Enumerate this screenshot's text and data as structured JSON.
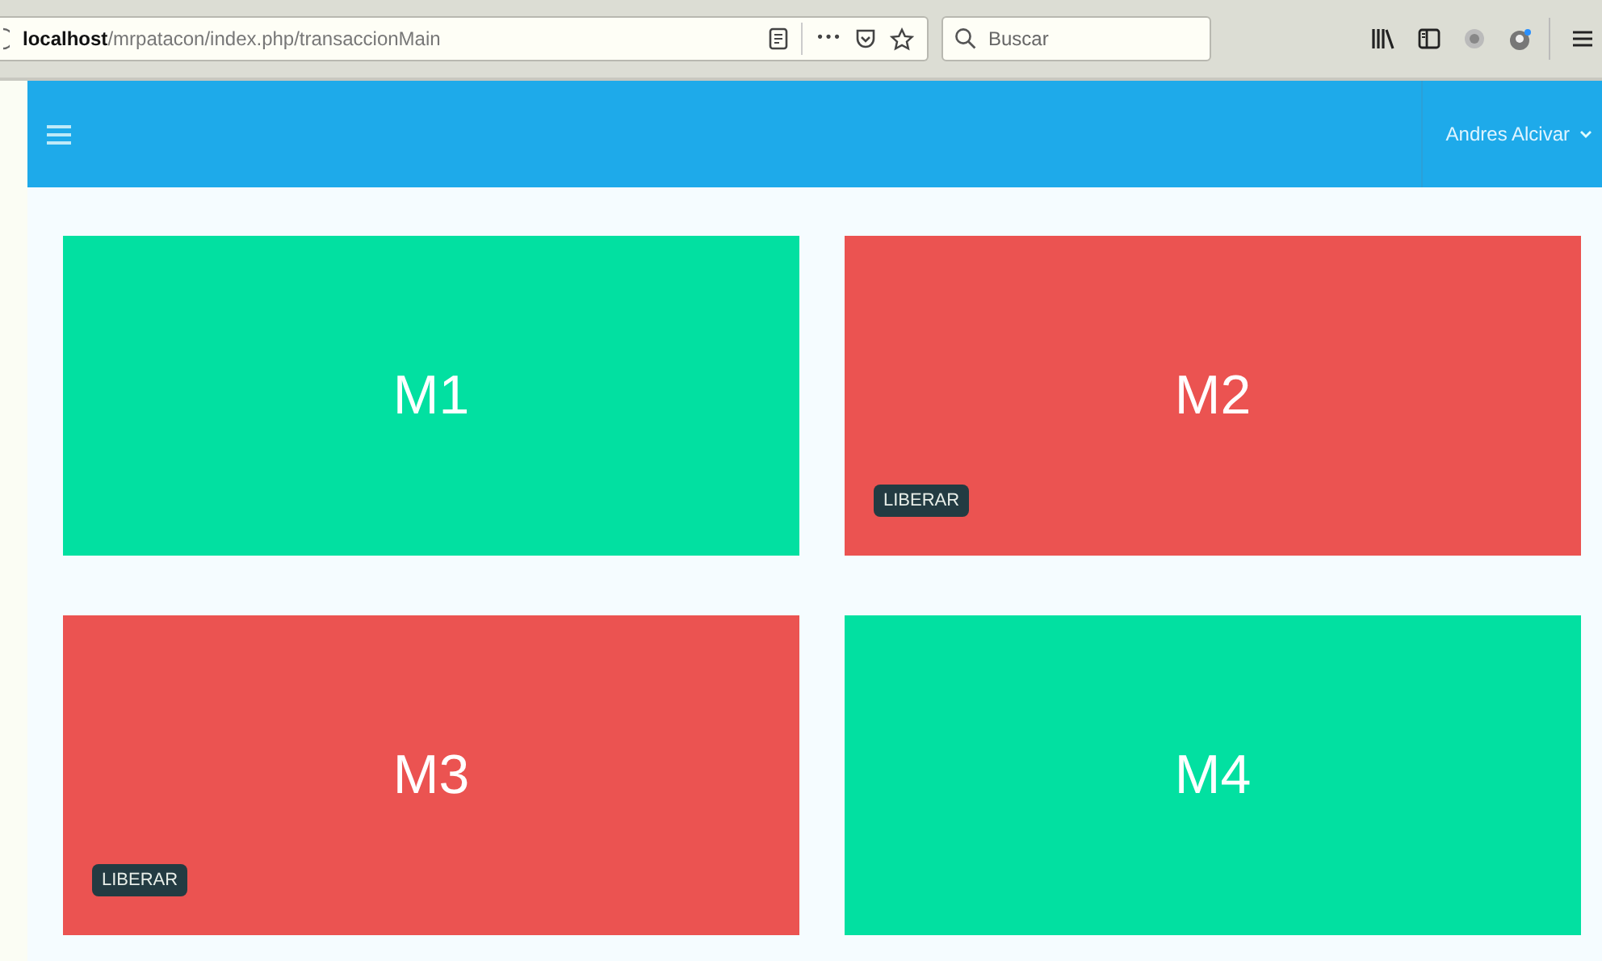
{
  "browser": {
    "url_host": "localhost",
    "url_path": "/mrpatacon/index.php/transaccionMain",
    "search": {
      "placeholder": "Buscar"
    },
    "menu_dots": "•••"
  },
  "navbar": {
    "user": "Andres Alcivar"
  },
  "tables": [
    {
      "name": "M1",
      "occupied": false
    },
    {
      "name": "M2",
      "occupied": true,
      "action": "LIBERAR"
    },
    {
      "name": "M3",
      "occupied": true,
      "action": "LIBERAR"
    },
    {
      "name": "M4",
      "occupied": false
    }
  ]
}
